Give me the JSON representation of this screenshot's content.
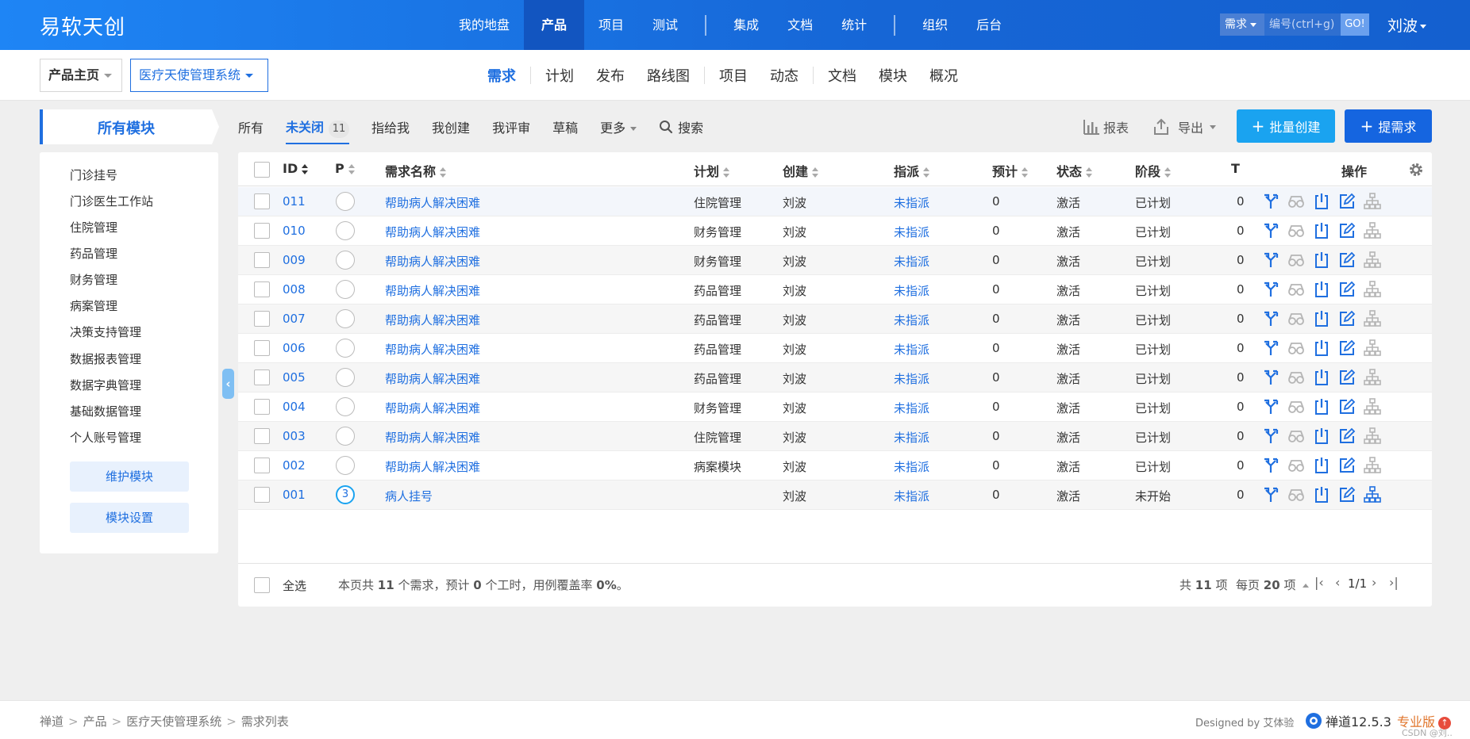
{
  "top": {
    "brand": "易软天创",
    "nav": [
      "我的地盘",
      "产品",
      "项目",
      "测试",
      "集成",
      "文档",
      "统计",
      "组织",
      "后台"
    ],
    "search_type": "需求",
    "search_placeholder": "编号(ctrl+g)",
    "go_label": "GO!",
    "user": "刘波"
  },
  "sub": {
    "home": "产品主页",
    "product": "医疗天使管理系统",
    "nav": [
      "需求",
      "计划",
      "发布",
      "路线图",
      "项目",
      "动态",
      "文档",
      "模块",
      "概况"
    ]
  },
  "modules": {
    "header": "所有模块",
    "items": [
      "门诊挂号",
      "门诊医生工作站",
      "住院管理",
      "药品管理",
      "财务管理",
      "病案管理",
      "决策支持管理",
      "数据报表管理",
      "数据字典管理",
      "基础数据管理",
      "个人账号管理"
    ],
    "maintain": "维护模块",
    "settings": "模块设置"
  },
  "filters": {
    "all": "所有",
    "open": "未关闭",
    "open_count": "11",
    "assigned": "指给我",
    "created": "我创建",
    "reviewed": "我评审",
    "draft": "草稿",
    "more": "更多",
    "search": "搜索",
    "report": "报表",
    "export": "导出",
    "batch_create": "批量创建",
    "new_story": "提需求"
  },
  "table": {
    "headers": {
      "id": "ID",
      "p": "P",
      "name": "需求名称",
      "plan": "计划",
      "creator": "创建",
      "assign": "指派",
      "estimate": "预计",
      "status": "状态",
      "stage": "阶段",
      "t": "T",
      "actions": "操作"
    },
    "rows": [
      {
        "id": "011",
        "pri": "",
        "name": "帮助病人解决困难",
        "plan": "住院管理",
        "creator": "刘波",
        "assign": "未指派",
        "estimate": "0",
        "status": "激活",
        "stage": "已计划",
        "t": "0"
      },
      {
        "id": "010",
        "pri": "",
        "name": "帮助病人解决困难",
        "plan": "财务管理",
        "creator": "刘波",
        "assign": "未指派",
        "estimate": "0",
        "status": "激活",
        "stage": "已计划",
        "t": "0"
      },
      {
        "id": "009",
        "pri": "",
        "name": "帮助病人解决困难",
        "plan": "财务管理",
        "creator": "刘波",
        "assign": "未指派",
        "estimate": "0",
        "status": "激活",
        "stage": "已计划",
        "t": "0"
      },
      {
        "id": "008",
        "pri": "",
        "name": "帮助病人解决困难",
        "plan": "药品管理",
        "creator": "刘波",
        "assign": "未指派",
        "estimate": "0",
        "status": "激活",
        "stage": "已计划",
        "t": "0"
      },
      {
        "id": "007",
        "pri": "",
        "name": "帮助病人解决困难",
        "plan": "药品管理",
        "creator": "刘波",
        "assign": "未指派",
        "estimate": "0",
        "status": "激活",
        "stage": "已计划",
        "t": "0"
      },
      {
        "id": "006",
        "pri": "",
        "name": "帮助病人解决困难",
        "plan": "药品管理",
        "creator": "刘波",
        "assign": "未指派",
        "estimate": "0",
        "status": "激活",
        "stage": "已计划",
        "t": "0"
      },
      {
        "id": "005",
        "pri": "",
        "name": "帮助病人解决困难",
        "plan": "药品管理",
        "creator": "刘波",
        "assign": "未指派",
        "estimate": "0",
        "status": "激活",
        "stage": "已计划",
        "t": "0"
      },
      {
        "id": "004",
        "pri": "",
        "name": "帮助病人解决困难",
        "plan": "财务管理",
        "creator": "刘波",
        "assign": "未指派",
        "estimate": "0",
        "status": "激活",
        "stage": "已计划",
        "t": "0"
      },
      {
        "id": "003",
        "pri": "",
        "name": "帮助病人解决困难",
        "plan": "住院管理",
        "creator": "刘波",
        "assign": "未指派",
        "estimate": "0",
        "status": "激活",
        "stage": "已计划",
        "t": "0"
      },
      {
        "id": "002",
        "pri": "",
        "name": "帮助病人解决困难",
        "plan": "病案模块",
        "creator": "刘波",
        "assign": "未指派",
        "estimate": "0",
        "status": "激活",
        "stage": "已计划",
        "t": "0"
      },
      {
        "id": "001",
        "pri": "3",
        "name": "病人挂号",
        "plan": "",
        "creator": "刘波",
        "assign": "未指派",
        "estimate": "0",
        "status": "激活",
        "stage": "未开始",
        "t": "0"
      }
    ],
    "footer": {
      "select_all": "全选",
      "summary_pre": "本页共",
      "summary_count": "11",
      "summary_mid": "个需求，预计",
      "summary_hours": "0",
      "summary_mid2": "个工时，用例覆盖率",
      "summary_rate": "0%",
      "summary_end": "。",
      "total_pre": "共",
      "total": "11",
      "total_unit": "项",
      "per_page_pre": "每页",
      "per_page": "20",
      "per_page_unit": "项",
      "page": "1/1"
    }
  },
  "footer": {
    "crumbs": [
      "禅道",
      "产品",
      "医疗天使管理系统",
      "需求列表"
    ],
    "designed_by": "Designed by 艾体验",
    "version": "禅道12.5.3",
    "edition": "专业版",
    "watermark": "CSDN @刘.."
  },
  "colors": {
    "brand_blue": "#1f6fe0",
    "topbar": "#1666d6",
    "batch_button": "#1aa3f0",
    "new_button": "#1565e0",
    "pro_orange": "#e0742a"
  }
}
